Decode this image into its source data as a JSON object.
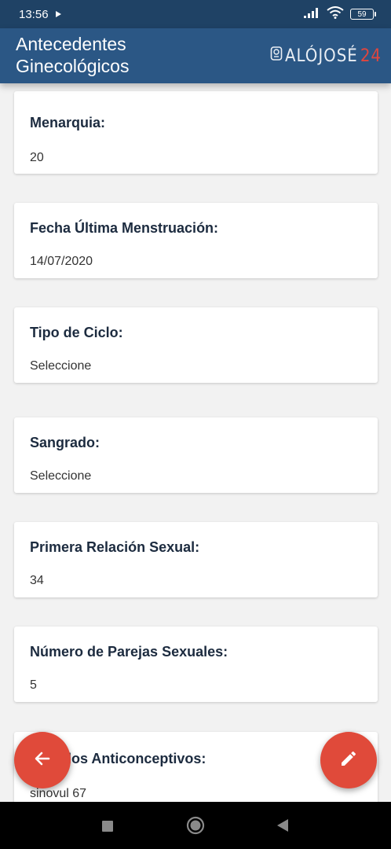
{
  "status_bar": {
    "time": "13:56",
    "battery": "59"
  },
  "app_bar": {
    "title_line1": "Antecedentes",
    "title_line2": "Ginecológicos",
    "logo_main": "ALÓJOSÉ",
    "logo_accent": "24"
  },
  "fields": [
    {
      "label": "Menarquia:",
      "value": "20"
    },
    {
      "label": "Fecha Última Menstruación:",
      "value": "14/07/2020"
    },
    {
      "label": "Tipo de Ciclo:",
      "value": "Seleccione"
    },
    {
      "label": "Sangrado:",
      "value": "Seleccione"
    },
    {
      "label": "Primera Relación Sexual:",
      "value": "34"
    },
    {
      "label": "Número de Parejas Sexuales:",
      "value": "5"
    },
    {
      "label": "Métodos Anticonceptivos:",
      "value": "sinovul 67"
    }
  ],
  "fab_back": {
    "icon": "arrow-left-icon"
  },
  "fab_edit": {
    "icon": "pencil-icon"
  },
  "colors": {
    "status_bar": "#1f4265",
    "app_bar": "#2b5785",
    "accent": "#e04a3a",
    "background": "#f2f2f2"
  }
}
